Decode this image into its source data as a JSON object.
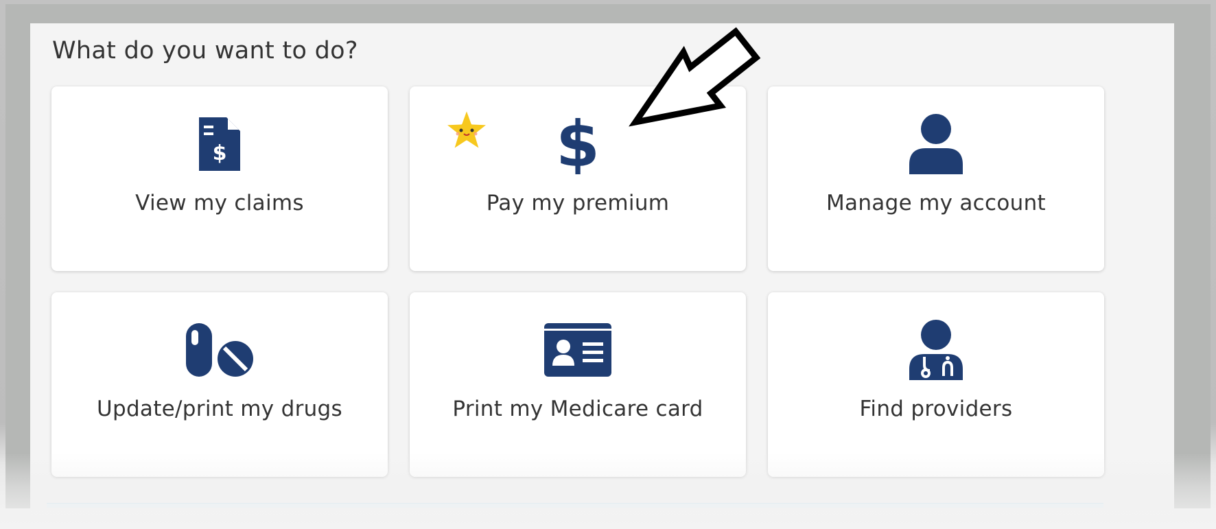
{
  "heading": "What do you want to do?",
  "colors": {
    "icon": "#1f3d72",
    "label": "#333333",
    "panel": "#f4f4f4",
    "tile": "#ffffff",
    "star": "#f7c81e"
  },
  "tiles": [
    {
      "label": "View my claims",
      "icon": "claim-document-icon"
    },
    {
      "label": "Pay my premium",
      "icon": "dollar-sign-icon"
    },
    {
      "label": "Manage my account",
      "icon": "user-icon"
    },
    {
      "label": "Update/print my drugs",
      "icon": "pills-icon"
    },
    {
      "label": "Print my Medicare card",
      "icon": "id-card-icon"
    },
    {
      "label": "Find providers",
      "icon": "doctor-icon"
    }
  ],
  "annotations": {
    "arrow_icon": "arrow-pointer-icon",
    "star_icon": "smiling-star-icon"
  }
}
